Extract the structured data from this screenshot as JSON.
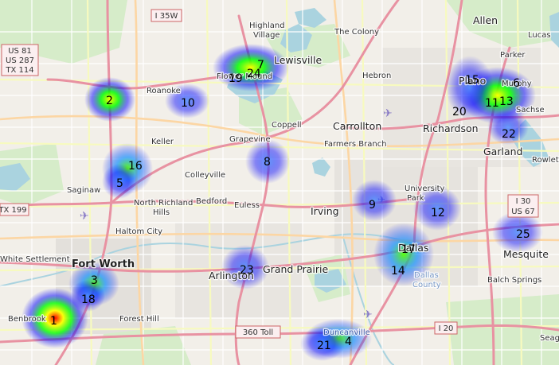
{
  "map": {
    "places": [
      {
        "id": "allen",
        "text": "Allen",
        "cls": "city"
      },
      {
        "id": "the-colony",
        "text": "The Colony",
        "cls": "town"
      },
      {
        "id": "lucas",
        "text": "Lucas",
        "cls": "town"
      },
      {
        "id": "highland-village",
        "text": "Highland\nVillage",
        "cls": "town"
      },
      {
        "id": "lewisville",
        "text": "Lewisville",
        "cls": "city"
      },
      {
        "id": "hebron",
        "text": "Hebron",
        "cls": "town"
      },
      {
        "id": "parker",
        "text": "Parker",
        "cls": "town"
      },
      {
        "id": "plano",
        "text": "Plano",
        "cls": "city"
      },
      {
        "id": "murphy",
        "text": "Murphy",
        "cls": "town"
      },
      {
        "id": "flower-mound",
        "text": "Flower Mound",
        "cls": "town"
      },
      {
        "id": "roanoke",
        "text": "Roanoke",
        "cls": "town"
      },
      {
        "id": "coppell",
        "text": "Coppell",
        "cls": "town"
      },
      {
        "id": "carrollton",
        "text": "Carrollton",
        "cls": "city"
      },
      {
        "id": "richardson",
        "text": "Richardson",
        "cls": "city"
      },
      {
        "id": "sachse",
        "text": "Sachse",
        "cls": "town"
      },
      {
        "id": "keller",
        "text": "Keller",
        "cls": "town"
      },
      {
        "id": "grapevine",
        "text": "Grapevine",
        "cls": "town"
      },
      {
        "id": "farmers-branch",
        "text": "Farmers Branch",
        "cls": "town"
      },
      {
        "id": "garland",
        "text": "Garland",
        "cls": "city"
      },
      {
        "id": "rowlett",
        "text": "Rowlett",
        "cls": "town"
      },
      {
        "id": "colleyville",
        "text": "Colleyville",
        "cls": "town"
      },
      {
        "id": "saginaw",
        "text": "Saginaw",
        "cls": "town"
      },
      {
        "id": "university-park",
        "text": "University\nPark",
        "cls": "town"
      },
      {
        "id": "bedford",
        "text": "Bedford",
        "cls": "town"
      },
      {
        "id": "euless",
        "text": "Euless",
        "cls": "town"
      },
      {
        "id": "north-richland-hills",
        "text": "North Richland\nHills",
        "cls": "town"
      },
      {
        "id": "irving",
        "text": "Irving",
        "cls": "city"
      },
      {
        "id": "haltom-city",
        "text": "Haltom City",
        "cls": "town"
      },
      {
        "id": "dallas",
        "text": "Dallas",
        "cls": "city"
      },
      {
        "id": "mesquite",
        "text": "Mesquite",
        "cls": "city"
      },
      {
        "id": "white-settlement",
        "text": "White Settlement",
        "cls": "town"
      },
      {
        "id": "fort-worth",
        "text": "Fort Worth",
        "cls": "big"
      },
      {
        "id": "grand-prairie",
        "text": "Grand Prairie",
        "cls": "city"
      },
      {
        "id": "arlington",
        "text": "Arlington",
        "cls": "city"
      },
      {
        "id": "dallas-county",
        "text": "Dallas\nCounty",
        "cls": "town"
      },
      {
        "id": "balch-springs",
        "text": "Balch Springs",
        "cls": "town"
      },
      {
        "id": "benbrook",
        "text": "Benbrook",
        "cls": "town"
      },
      {
        "id": "forest-hill",
        "text": "Forest Hill",
        "cls": "town"
      },
      {
        "id": "duncanville",
        "text": "Duncanville",
        "cls": "town"
      },
      {
        "id": "seagoville",
        "text": "Seago",
        "cls": "town"
      }
    ],
    "shields": [
      {
        "id": "i35w",
        "lines": [
          "I 35W"
        ]
      },
      {
        "id": "us81",
        "lines": [
          "US 81",
          "US 287",
          "TX 114"
        ]
      },
      {
        "id": "tx199",
        "lines": [
          "TX 199"
        ]
      },
      {
        "id": "i30",
        "lines": [
          "I 30",
          "US 67"
        ]
      },
      {
        "id": "toll360",
        "lines": [
          "360 Toll"
        ]
      },
      {
        "id": "i20",
        "lines": [
          "I 20"
        ]
      }
    ],
    "hotspots": [
      {
        "n": "1",
        "intensity": 1.0
      },
      {
        "n": "2",
        "intensity": 0.78
      },
      {
        "n": "3",
        "intensity": 0.55
      },
      {
        "n": "4",
        "intensity": 0.5
      },
      {
        "n": "5",
        "intensity": 0.55
      },
      {
        "n": "6",
        "intensity": 0.55
      },
      {
        "n": "7",
        "intensity": 0.75
      },
      {
        "n": "8",
        "intensity": 0.42
      },
      {
        "n": "9",
        "intensity": 0.42
      },
      {
        "n": "10",
        "intensity": 0.38
      },
      {
        "n": "11",
        "intensity": 0.7
      },
      {
        "n": "12",
        "intensity": 0.42
      },
      {
        "n": "13",
        "intensity": 0.7
      },
      {
        "n": "14",
        "intensity": 0.55
      },
      {
        "n": "15",
        "intensity": 0.45
      },
      {
        "n": "16",
        "intensity": 0.6
      },
      {
        "n": "17",
        "intensity": 0.62
      },
      {
        "n": "18",
        "intensity": 0.5
      },
      {
        "n": "19",
        "intensity": 0.6
      },
      {
        "n": "20",
        "intensity": 0.45
      },
      {
        "n": "21",
        "intensity": 0.45
      },
      {
        "n": "22",
        "intensity": 0.45
      },
      {
        "n": "23",
        "intensity": 0.42
      },
      {
        "n": "24",
        "intensity": 0.75
      },
      {
        "n": "25",
        "intensity": 0.45
      }
    ]
  }
}
